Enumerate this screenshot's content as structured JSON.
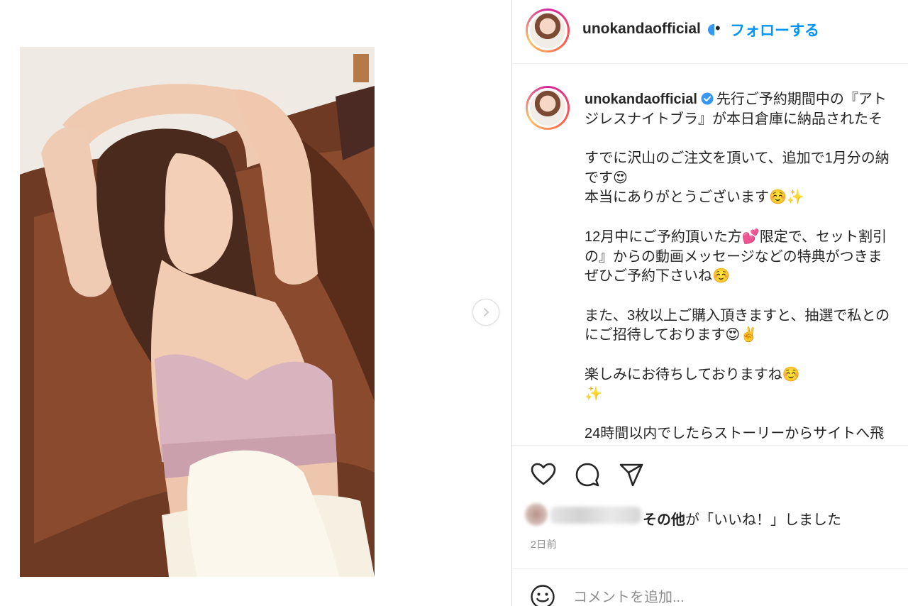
{
  "post": {
    "username": "unokandaofficial",
    "header_separator": "•",
    "follow_label": "フォローする",
    "caption_lines": [
      "先行ご予約期間中の『アト",
      "ジレスナイトブラ』が本日倉庫に納品されたそ",
      "",
      "すでに沢山のご注文を頂いて、追加で1月分の納",
      "です😍",
      "本当にありがとうございます☺️✨",
      "",
      "12月中にご予約頂いた方💕限定で、セット割引",
      "の』からの動画メッセージなどの特典がつきま",
      "ぜひご予約下さいね☺️",
      "",
      "また、3枚以上ご購入頂きますと、抽選で私との",
      "にご招待しております😍✌️",
      "",
      "楽しみにお待ちしておりますね☺️",
      "✨",
      "",
      "24時間以内でしたらストーリーからサイトへ飛"
    ],
    "likes": {
      "others": "その他",
      "suffix": "が「いいね！」しました"
    },
    "timestamp": "2日前",
    "comment_placeholder": "コメントを追加..."
  },
  "icons": {
    "verified": "verified-badge-icon",
    "like": "heart-icon",
    "comment": "comment-icon",
    "share": "paper-plane-icon",
    "emoji": "smiley-icon",
    "next": "chevron-right-icon"
  },
  "colors": {
    "accent": "#0095f6",
    "verified": "#3897f0",
    "text": "#262626",
    "muted": "#8e8e8e",
    "border": "#dbdbdb"
  }
}
